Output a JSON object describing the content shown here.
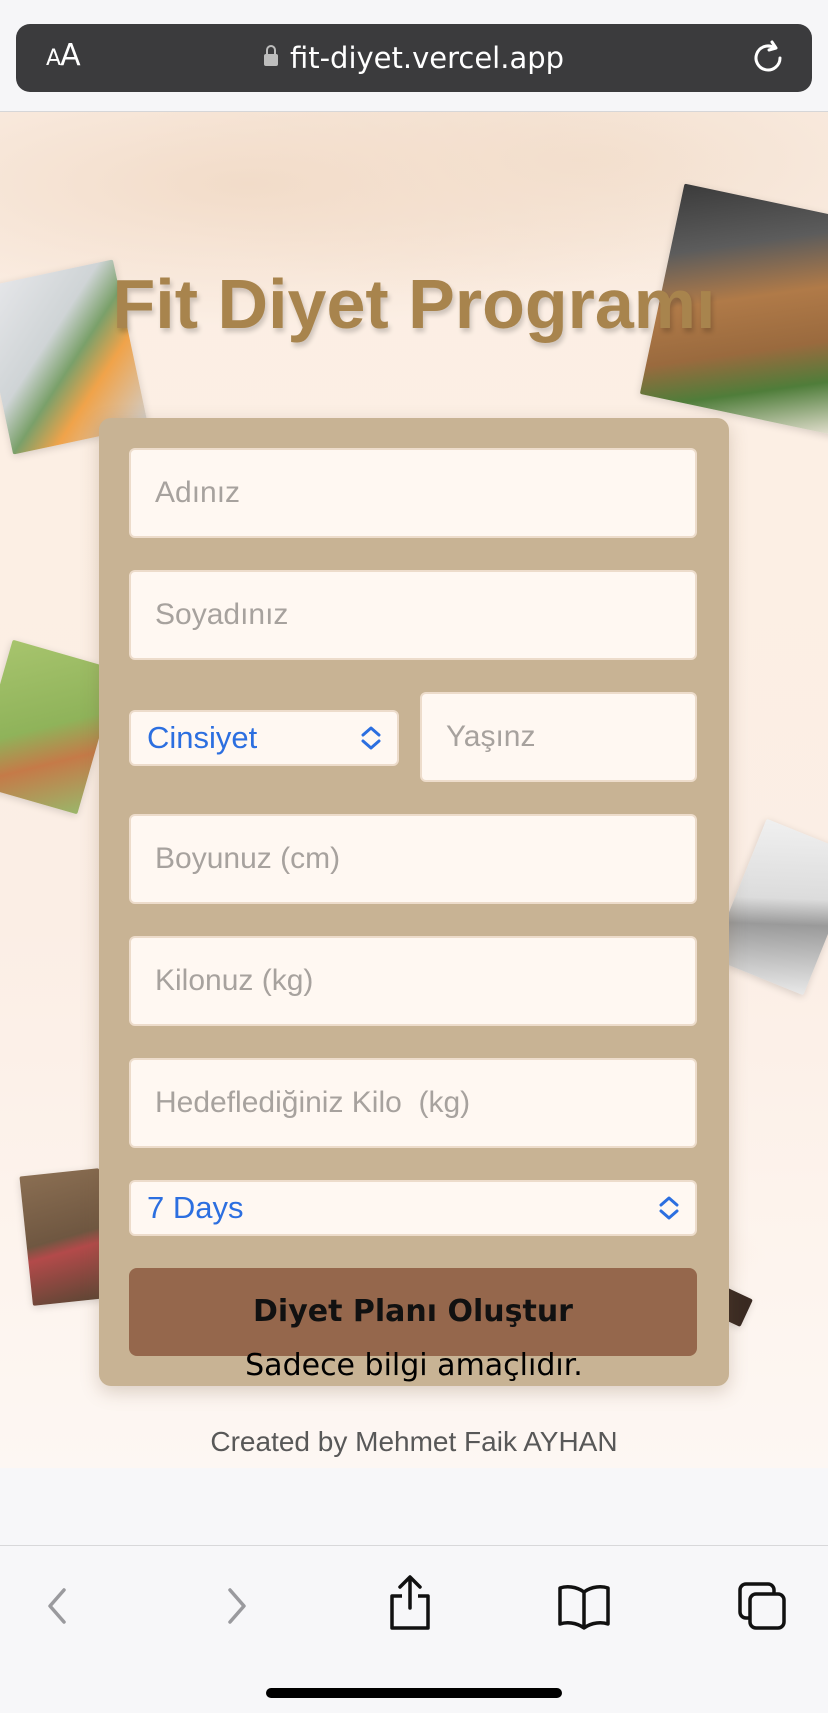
{
  "browser": {
    "aa_label": "AA",
    "url": "fit-diyet.vercel.app"
  },
  "page": {
    "title": "Fit Diyet Programı"
  },
  "form": {
    "name_placeholder": "Adınız",
    "surname_placeholder": "Soyadınız",
    "gender_selected": "Cinsiyet",
    "age_placeholder": "Yaşınz",
    "height_placeholder": "Boyunuz (cm)",
    "weight_placeholder": "Kilonuz (kg)",
    "target_weight_placeholder": "Hedeflediğiniz Kilo  (kg)",
    "duration_selected": "7 Days",
    "submit_label": "Diyet Planı Oluştur"
  },
  "footer": {
    "credit": "Created by Mehmet Faik AYHAN",
    "disclaimer": "Sadece bilgi amaçlıdır."
  },
  "colors": {
    "title": "#a8844d",
    "card": "#c8b394",
    "button": "#95674c",
    "select_text": "#2c6fe0"
  },
  "icons": [
    "lock-icon",
    "reload-icon",
    "back-icon",
    "forward-icon",
    "share-icon",
    "bookmarks-icon",
    "tabs-icon",
    "select-chevron-icon"
  ]
}
